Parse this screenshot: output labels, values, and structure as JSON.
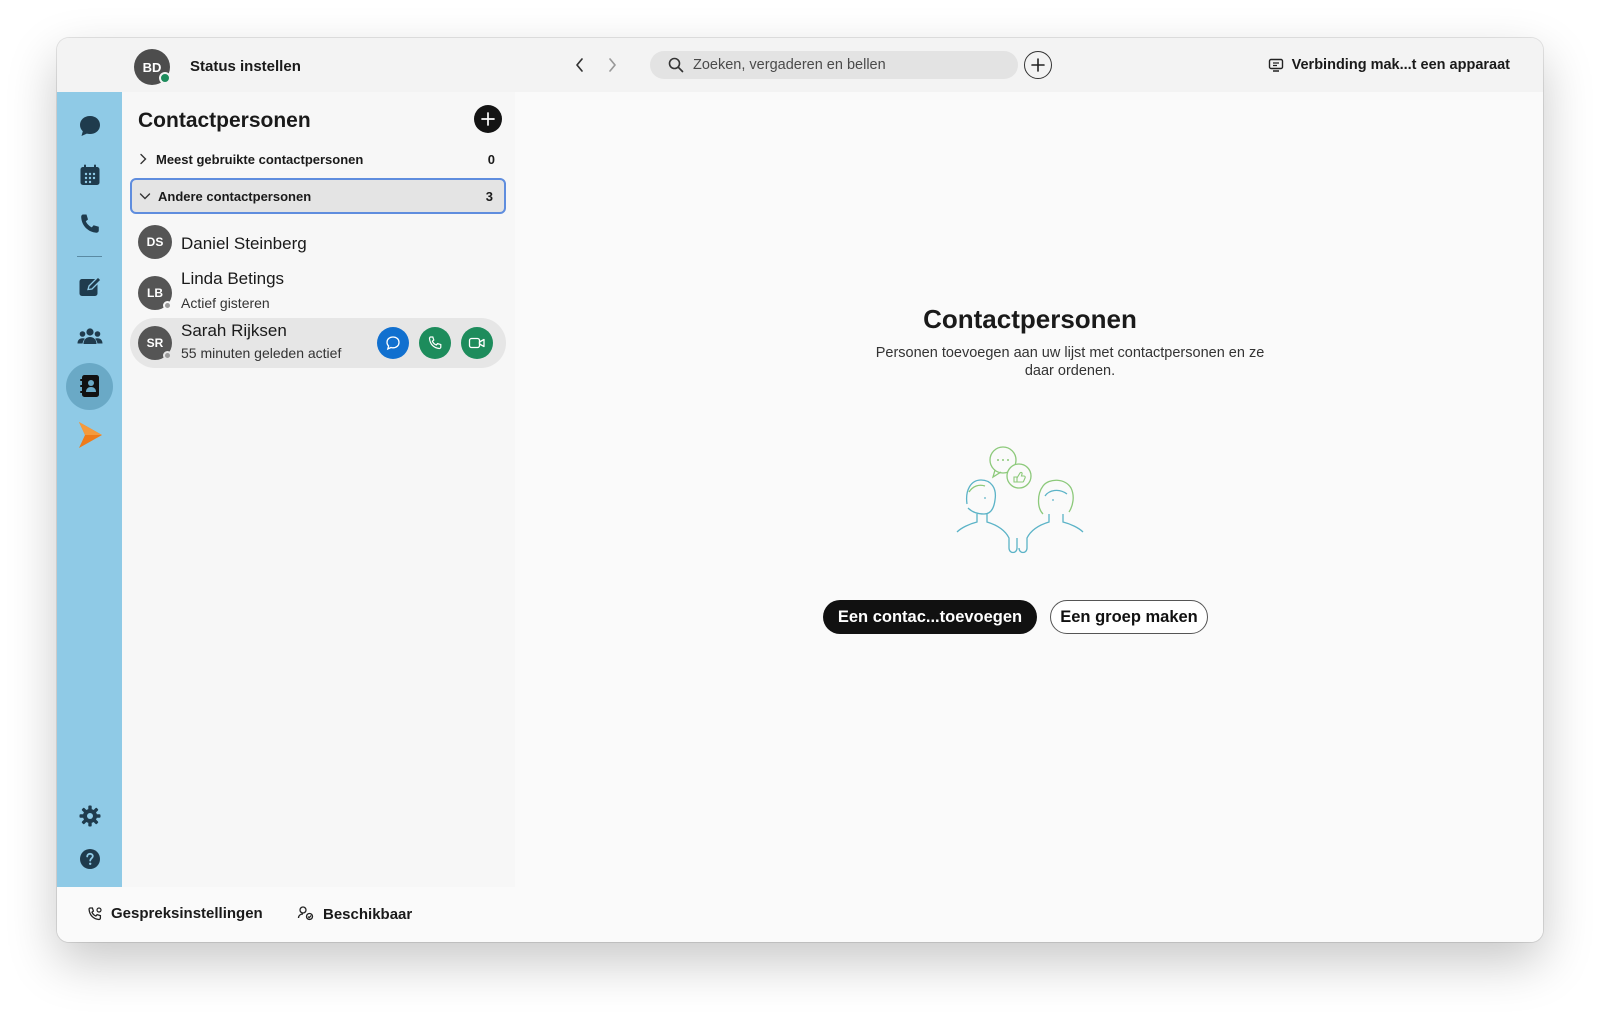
{
  "titlebar": {
    "user_initials": "BD",
    "status_label": "Status instellen",
    "search_placeholder": "Zoeken, vergaderen en bellen",
    "connect_label": "Verbinding mak...t een apparaat"
  },
  "rail": {
    "items": [
      "chat-icon",
      "calendar-icon",
      "phone-icon",
      "compose-icon",
      "team-icon",
      "contacts-icon",
      "app-icon"
    ],
    "bottom": [
      "settings-icon",
      "help-icon"
    ],
    "accent": "#8fcae6"
  },
  "panel": {
    "title": "Contactpersonen",
    "groups": [
      {
        "label": "Meest gebruikte contactpersonen",
        "count": "0"
      },
      {
        "label": "Andere contactpersonen",
        "count": "3"
      }
    ],
    "contacts": [
      {
        "initials": "DS",
        "name": "Daniel Steinberg",
        "status": ""
      },
      {
        "initials": "LB",
        "name": "Linda Betings",
        "status": "Actief gisteren"
      },
      {
        "initials": "SR",
        "name": "Sarah Rijksen",
        "status": "55 minuten geleden actief"
      }
    ]
  },
  "main": {
    "title": "Contactpersonen",
    "description": "Personen toevoegen aan uw lijst met contactpersonen en ze daar ordenen.",
    "primary_button": "Een contac...toevoegen",
    "secondary_button": "Een groep maken"
  },
  "footer": {
    "call_settings": "Gespreksinstellingen",
    "availability": "Beschikbaar"
  },
  "colors": {
    "chat_action": "#1170cf",
    "call_action": "#1d8c5c",
    "video_action": "#1d8c5c",
    "selection_border": "#5f8dde"
  }
}
